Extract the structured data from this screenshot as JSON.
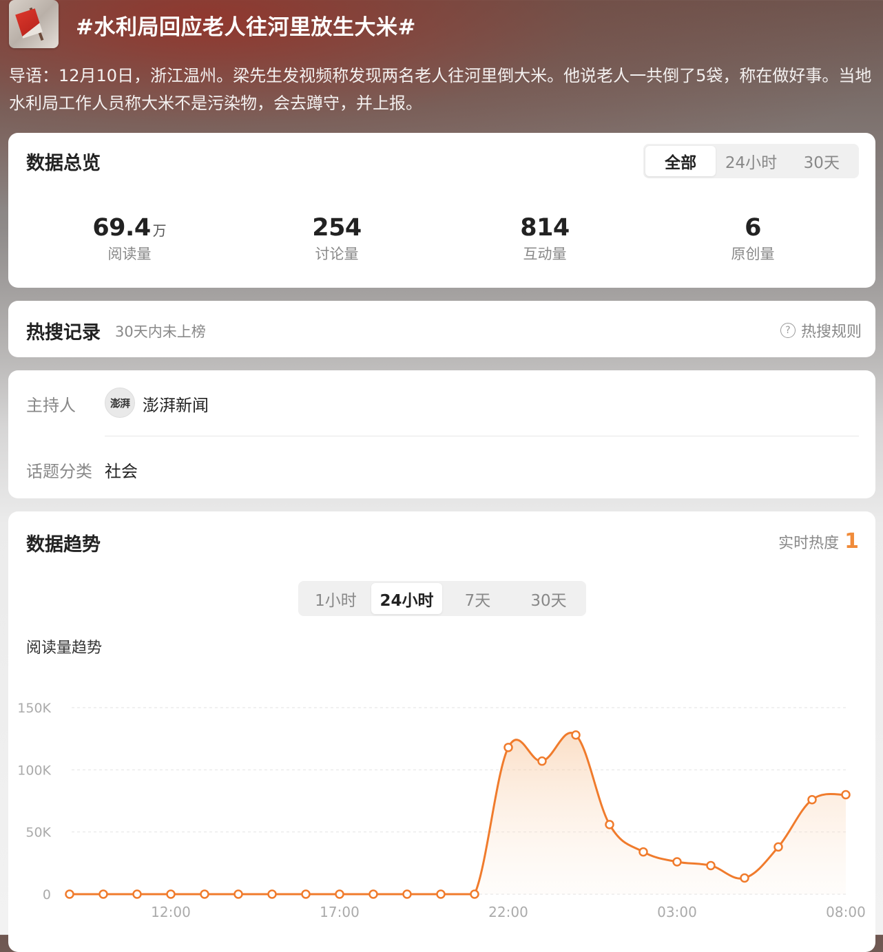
{
  "topic": {
    "title": "#水利局回应老人往河里放生大米#",
    "intro": "导语：12月10日，浙江温州。梁先生发视频称发现两名老人往河里倒大米。他说老人一共倒了5袋，称在做好事。当地水利局工作人员称大米不是污染物，会去蹲守，并上报。"
  },
  "overview": {
    "title": "数据总览",
    "tabs": [
      {
        "label": "全部",
        "active": true
      },
      {
        "label": "24小时",
        "active": false
      },
      {
        "label": "30天",
        "active": false
      }
    ],
    "stats": [
      {
        "value": "69.4",
        "unit": "万",
        "label": "阅读量"
      },
      {
        "value": "254",
        "unit": "",
        "label": "讨论量"
      },
      {
        "value": "814",
        "unit": "",
        "label": "互动量"
      },
      {
        "value": "6",
        "unit": "",
        "label": "原创量"
      }
    ]
  },
  "hot_record": {
    "title": "热搜记录",
    "note": "30天内未上榜",
    "rule_icon": "question-circle-icon",
    "rule_label": "热搜规则"
  },
  "info": {
    "host_label": "主持人",
    "host_avatar_text": "澎湃",
    "host_name": "澎湃新闻",
    "category_label": "话题分类",
    "category_value": "社会"
  },
  "trend": {
    "title": "数据趋势",
    "realtime_label": "实时热度",
    "realtime_rank": "1",
    "tabs": [
      {
        "label": "1小时",
        "active": false
      },
      {
        "label": "24小时",
        "active": true
      },
      {
        "label": "7天",
        "active": false
      },
      {
        "label": "30天",
        "active": false
      }
    ],
    "chart_title": "阅读量趋势"
  },
  "colors": {
    "accent": "#f08b3a",
    "line": "#f07b2c"
  },
  "chart_data": {
    "type": "area",
    "title": "阅读量趋势",
    "xlabel": "",
    "ylabel": "",
    "x_ticks": [
      "12:00",
      "17:00",
      "22:00",
      "03:00",
      "08:00"
    ],
    "y_ticks": [
      "0",
      "50K",
      "100K",
      "150K"
    ],
    "ylim": [
      0,
      150000
    ],
    "x": [
      "09:00",
      "10:00",
      "11:00",
      "12:00",
      "13:00",
      "14:00",
      "15:00",
      "16:00",
      "17:00",
      "18:00",
      "19:00",
      "20:00",
      "21:00",
      "22:00",
      "23:00",
      "00:00",
      "01:00",
      "02:00",
      "03:00",
      "04:00",
      "05:00",
      "06:00",
      "07:00",
      "08:00"
    ],
    "series": [
      {
        "values": [
          0,
          0,
          0,
          0,
          0,
          0,
          0,
          0,
          0,
          0,
          0,
          0,
          0,
          118000,
          107000,
          128000,
          56000,
          34000,
          26000,
          23000,
          13000,
          38000,
          76000,
          80000
        ]
      }
    ],
    "grid": true,
    "legend": "none"
  }
}
